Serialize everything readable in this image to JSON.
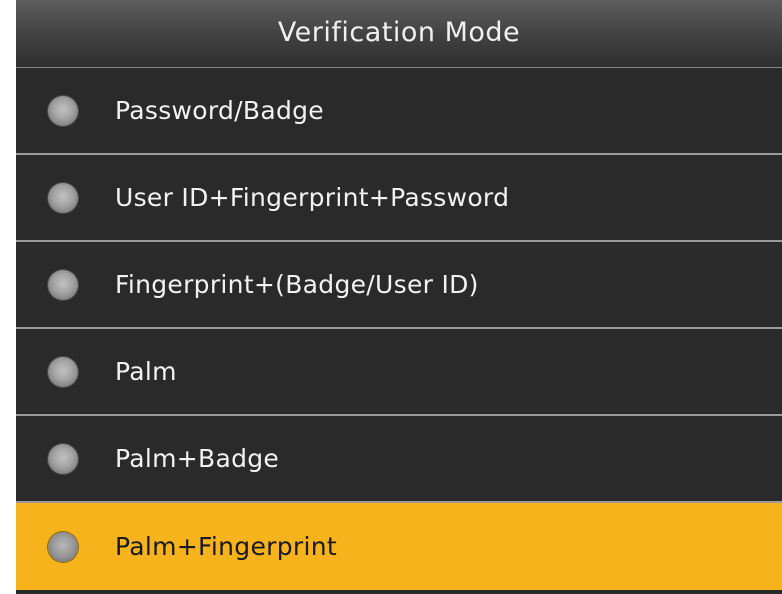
{
  "header": {
    "title": "Verification Mode"
  },
  "options": [
    {
      "label": "Password/Badge",
      "selected": false
    },
    {
      "label": "User ID+Fingerprint+Password",
      "selected": false
    },
    {
      "label": "Fingerprint+(Badge/User ID)",
      "selected": false
    },
    {
      "label": "Palm",
      "selected": false
    },
    {
      "label": "Palm+Badge",
      "selected": false
    },
    {
      "label": "Palm+Fingerprint",
      "selected": true
    }
  ],
  "colors": {
    "background": "#2a2a2a",
    "highlight": "#f6b31b",
    "divider": "#9a9a9a"
  }
}
